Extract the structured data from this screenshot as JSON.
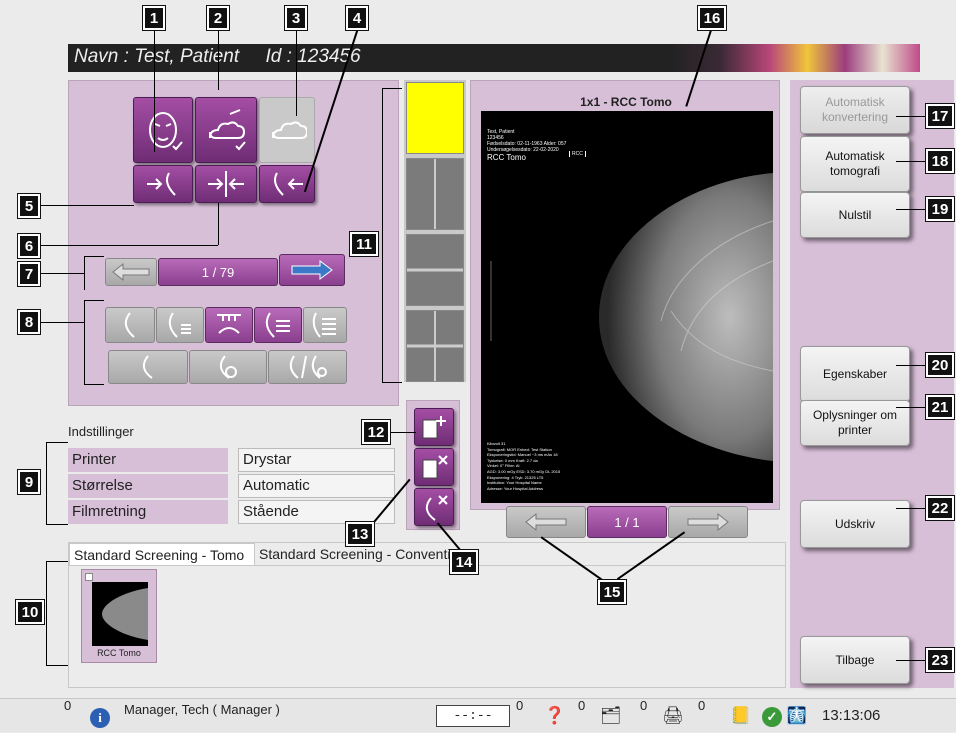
{
  "header": {
    "patient_title": "Navn : Test, Patient     Id : 123456"
  },
  "callouts": [
    "1",
    "2",
    "3",
    "4",
    "5",
    "6",
    "7",
    "8",
    "9",
    "10",
    "11",
    "12",
    "13",
    "14",
    "15",
    "16",
    "17",
    "18",
    "19",
    "20",
    "21",
    "22",
    "23"
  ],
  "nav": {
    "image_counter": "1 / 79"
  },
  "settings": {
    "heading": "Indstillinger",
    "rows": [
      {
        "label": "Printer",
        "value": "Drystar"
      },
      {
        "label": "Størrelse",
        "value": "Automatic"
      },
      {
        "label": "Filmretning",
        "value": "Stående"
      }
    ]
  },
  "viewer": {
    "title": "1x1 - RCC Tomo",
    "page_counter": "1 / 1",
    "overlay_top": [
      "Test, Patient",
      "123456",
      "Fødselsdato: 02-11-1963  Alder: 057",
      "Undersøgelsesdato: 22-02-2020",
      "RCC Tomo"
    ],
    "overlay_marker": "RCC",
    "overlay_bottom": [
      "Kilovolt 31",
      "Tomografi: MOR  Enhed: Test Station",
      "Eksponeringstid: Manuel  ~3 ms  mAs 18",
      "Tykkelse: 0 mm  Kraft: 2.7 da",
      "Vinkel: 0°  Filter: Al",
      "AGD: 3.00 mGy  ESD: 3.70 mGy  DL 2015",
      "Eksponering: 4  Tryk: 21325  LT5",
      "Institution: Your Hospital Name",
      "Adresse: Your Hospital Address"
    ]
  },
  "right_buttons": {
    "auto_convert": "Automatisk konvertering",
    "auto_tomo": "Automatisk tomografi",
    "reset": "Nulstil",
    "properties": "Egenskaber",
    "printer_info": "Oplysninger om printer",
    "print": "Udskriv",
    "back": "Tilbage"
  },
  "tabs": [
    {
      "label": "Standard Screening - Tomo"
    },
    {
      "label": "Standard Screening - Conventional"
    }
  ],
  "thumbnail": {
    "label": "RCC Tomo"
  },
  "status": {
    "count1": "0",
    "user": "Manager, Tech ( Manager )",
    "clock_display": "--:--",
    "count2": "0",
    "count3": "0",
    "count4": "0",
    "count5": "0",
    "time": "13:13:06"
  },
  "colors": {
    "panel": "#d8bfd8",
    "button": "#8a3f8f",
    "callout": "#111111",
    "yellow": "#ffff00"
  }
}
